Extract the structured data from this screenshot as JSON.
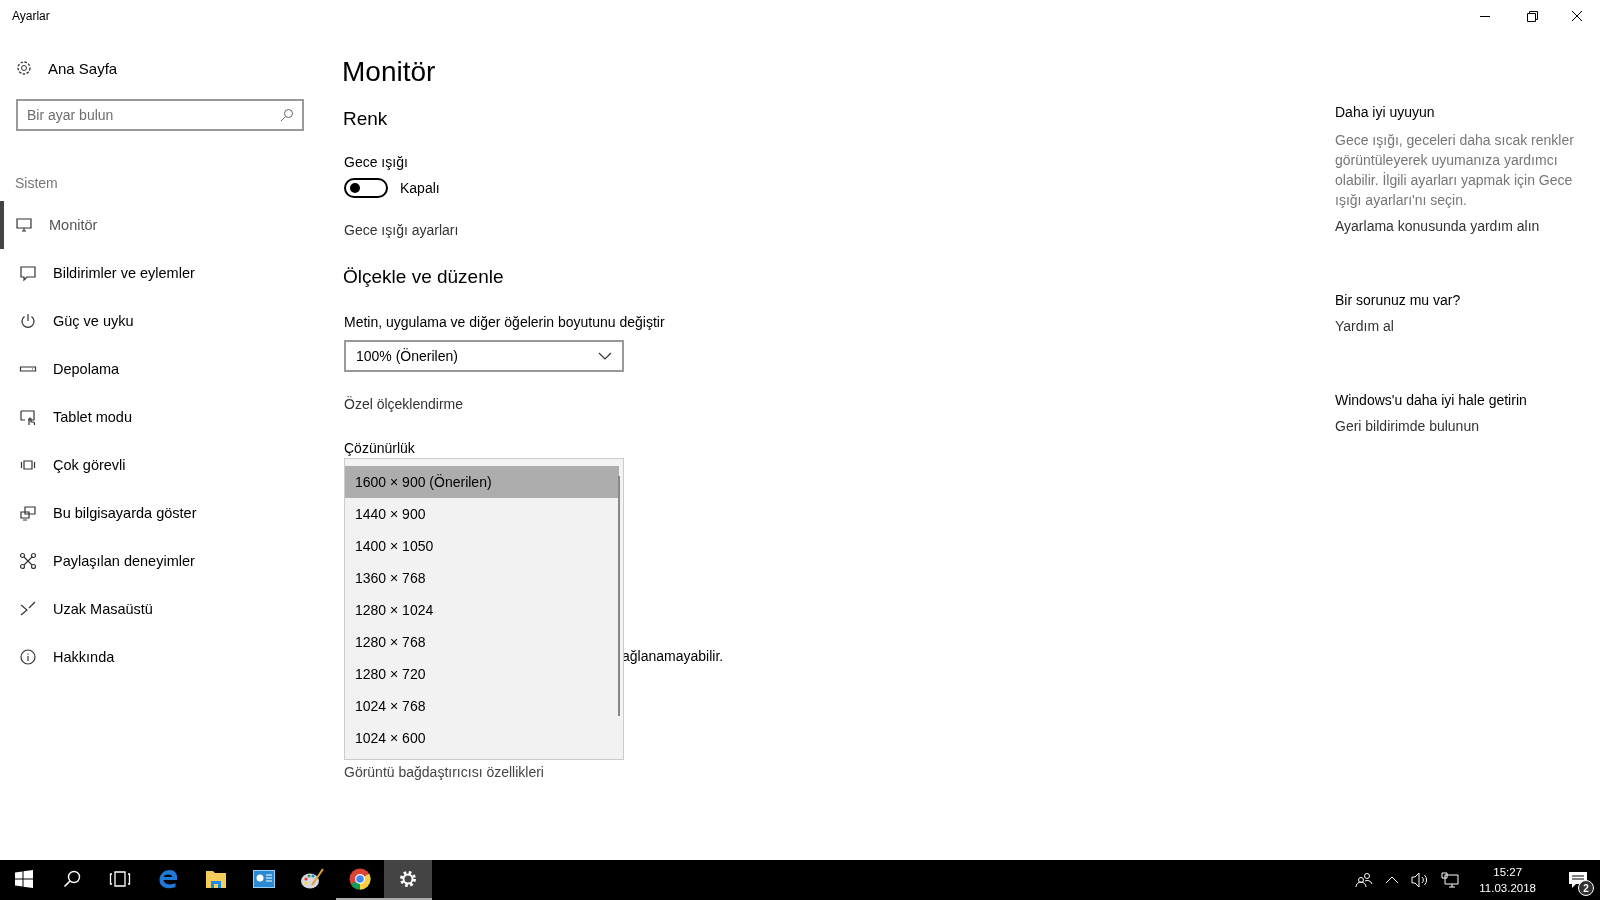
{
  "window": {
    "title": "Ayarlar"
  },
  "sidebar": {
    "home": "Ana Sayfa",
    "search": {
      "placeholder": "Bir ayar bulun"
    },
    "section": "Sistem",
    "items": [
      {
        "label": "Monitör",
        "kind": "monitor",
        "selected": true
      },
      {
        "label": "Bildirimler ve eylemler",
        "kind": "notifications",
        "selected": false
      },
      {
        "label": "Güç ve uyku",
        "kind": "power",
        "selected": false
      },
      {
        "label": "Depolama",
        "kind": "storage",
        "selected": false
      },
      {
        "label": "Tablet modu",
        "kind": "tablet",
        "selected": false
      },
      {
        "label": "Çok görevli",
        "kind": "multitask",
        "selected": false
      },
      {
        "label": "Bu bilgisayarda göster",
        "kind": "project",
        "selected": false
      },
      {
        "label": "Paylaşılan deneyimler",
        "kind": "shared",
        "selected": false
      },
      {
        "label": "Uzak Masaüstü",
        "kind": "remote",
        "selected": false
      },
      {
        "label": "Hakkında",
        "kind": "about",
        "selected": false
      }
    ]
  },
  "main": {
    "title": "Monitör",
    "color_heading": "Renk",
    "night_light": {
      "label": "Gece ışığı",
      "on": false,
      "state": "Kapalı"
    },
    "night_light_link": "Gece ışığı ayarları",
    "scale_heading": "Ölçekle ve düzenle",
    "scale_label": "Metin, uygulama ve diğer öğelerin boyutunu değiştir",
    "scale_value": "100% (Önerilen)",
    "custom_scale_link": "Özel ölçeklendirme",
    "resolution_label": "Çözünürlük",
    "resolution_options": [
      {
        "label": "1600 × 900 (Önerilen)",
        "selected": true
      },
      {
        "label": "1440 × 900",
        "selected": false
      },
      {
        "label": "1400 × 1050",
        "selected": false
      },
      {
        "label": "1360 × 768",
        "selected": false
      },
      {
        "label": "1280 × 1024",
        "selected": false
      },
      {
        "label": "1280 × 768",
        "selected": false
      },
      {
        "label": "1280 × 720",
        "selected": false
      },
      {
        "label": "1024 × 768",
        "selected": false
      },
      {
        "label": "1024 × 600",
        "selected": false
      }
    ],
    "partial_text": "ağlanamayabilir.",
    "adapter_link": "Görüntü bağdaştırıcısı özellikleri"
  },
  "right_panel": [
    {
      "heading": "Daha iyi uyuyun",
      "body": "Gece ışığı, geceleri daha sıcak renkler görüntüleyerek uyumanıza yardımcı olabilir. İlgili ayarları yapmak için Gece ışığı ayarları'nı seçin.",
      "link": "Ayarlama konusunda yardım alın"
    },
    {
      "heading": "Bir sorunuz mu var?",
      "link": "Yardım al"
    },
    {
      "heading": "Windows'u daha iyi hale getirin",
      "link": "Geri bildirimde bulunun"
    }
  ],
  "taskbar": {
    "apps": [
      {
        "kind": "start",
        "selected": false,
        "running": false
      },
      {
        "kind": "search",
        "selected": false,
        "running": false
      },
      {
        "kind": "taskview",
        "selected": false,
        "running": false
      },
      {
        "kind": "edge",
        "selected": false,
        "running": false
      },
      {
        "kind": "explorer",
        "selected": false,
        "running": false
      },
      {
        "kind": "dashboard",
        "selected": false,
        "running": false
      },
      {
        "kind": "paint",
        "selected": false,
        "running": false
      },
      {
        "kind": "chrome",
        "selected": false,
        "running": true
      },
      {
        "kind": "settings",
        "selected": true,
        "running": true
      }
    ],
    "time": "15:27",
    "date": "11.03.2018",
    "notification_count": "2"
  }
}
